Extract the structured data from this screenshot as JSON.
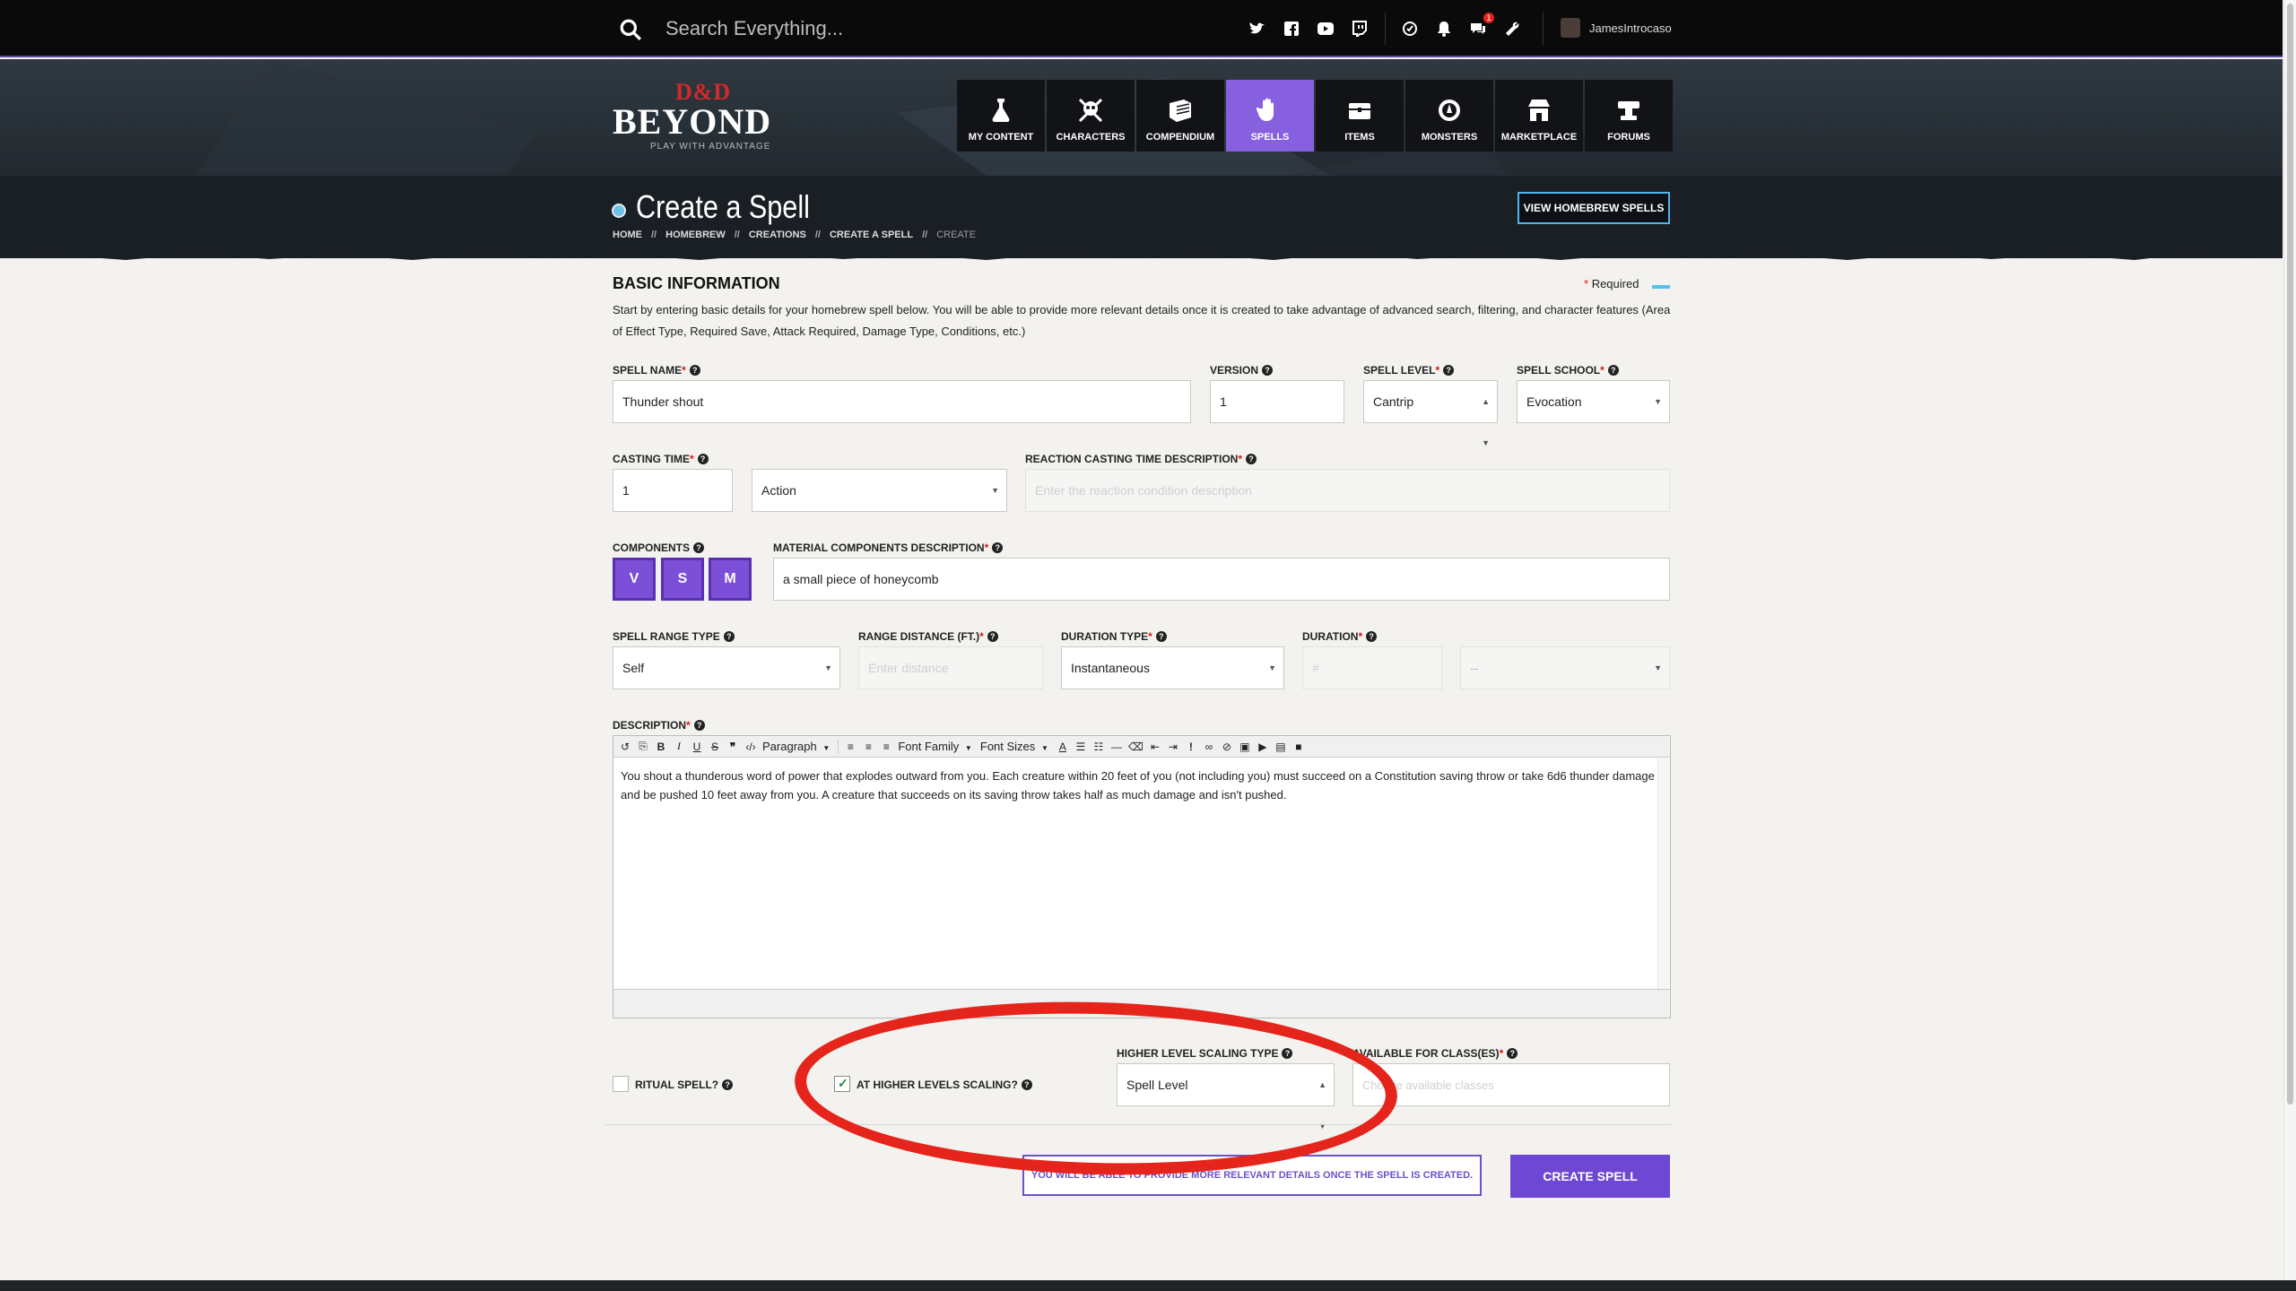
{
  "topbar": {
    "search_placeholder": "Search Everything...",
    "social_icons": [
      "twitter-icon",
      "facebook-icon",
      "youtube-icon",
      "twitch-icon"
    ],
    "notification_badge": "1",
    "username": "JamesIntrocaso"
  },
  "logo": {
    "mark": "D&D",
    "name": "BEYOND",
    "tagline": "PLAY WITH ADVANTAGE"
  },
  "nav": {
    "items": [
      {
        "label": "MY CONTENT",
        "icon": "potion-icon"
      },
      {
        "label": "CHARACTERS",
        "icon": "skull-crossbones-icon"
      },
      {
        "label": "COMPENDIUM",
        "icon": "book-icon"
      },
      {
        "label": "SPELLS",
        "icon": "hand-spell-icon",
        "active": true
      },
      {
        "label": "ITEMS",
        "icon": "chest-icon"
      },
      {
        "label": "MONSTERS",
        "icon": "monster-icon"
      },
      {
        "label": "MARKETPLACE",
        "icon": "shop-icon"
      },
      {
        "label": "FORUMS",
        "icon": "anvil-icon"
      }
    ],
    "active_color": "#8760e0"
  },
  "header": {
    "title": "Create a Spell",
    "breadcrumbs": [
      "HOME",
      "HOMEBREW",
      "CREATIONS",
      "CREATE A SPELL"
    ],
    "breadcrumb_current": "CREATE",
    "breadcrumb_sep": "//",
    "homebrew_button": "VIEW HOMEBREW SPELLS"
  },
  "form": {
    "section_title": "BASIC INFORMATION",
    "required_note": "Required",
    "required_mark": "*",
    "intro": "Start by entering basic details for your homebrew spell below. You will be able to provide more relevant details once it is created to take advantage of advanced search, filtering, and character features (Area of Effect Type, Required Save, Attack Required, Damage Type, Conditions, etc.)",
    "spell_name": {
      "label": "SPELL NAME",
      "value": "Thunder shout"
    },
    "version": {
      "label": "VERSION",
      "value": "1"
    },
    "spell_level": {
      "label": "SPELL LEVEL",
      "value": "Cantrip"
    },
    "spell_school": {
      "label": "SPELL SCHOOL",
      "value": "Evocation"
    },
    "casting_time": {
      "label": "CASTING TIME",
      "value": "1",
      "unit": "Action"
    },
    "reaction_desc": {
      "label": "REACTION CASTING TIME DESCRIPTION",
      "placeholder": "Enter the reaction condition description"
    },
    "components": {
      "label": "COMPONENTS",
      "buttons": [
        "V",
        "S",
        "M"
      ]
    },
    "material_desc": {
      "label": "MATERIAL COMPONENTS DESCRIPTION",
      "value": "a small piece of honeycomb"
    },
    "range_type": {
      "label": "SPELL RANGE TYPE",
      "value": "Self"
    },
    "range_distance": {
      "label": "RANGE DISTANCE (FT.)",
      "placeholder": "Enter distance"
    },
    "duration_type": {
      "label": "DURATION TYPE",
      "value": "Instantaneous"
    },
    "duration": {
      "label": "DURATION",
      "placeholder": "#",
      "unit": "--"
    },
    "description": {
      "label": "DESCRIPTION",
      "toolbar": {
        "paragraph": "Paragraph",
        "font_family": "Font Family",
        "font_sizes": "Font Sizes"
      },
      "text": "You shout a thunderous word of power that explodes outward from you. Each creature within 20 feet of you (not including you) must succeed on a Constitution saving throw or take 6d6 thunder damage and be pushed 10 feet away from you. A creature that succeeds on its saving throw takes half as much damage and isn't pushed."
    },
    "ritual": {
      "label": "RITUAL SPELL?",
      "checked": false
    },
    "higher_levels": {
      "label": "AT HIGHER LEVELS SCALING?",
      "checked": true
    },
    "scaling_type": {
      "label": "HIGHER LEVEL SCALING TYPE",
      "value": "Spell Level"
    },
    "classes": {
      "label": "AVAILABLE FOR CLASS(ES)",
      "placeholder": "Choose available classes"
    },
    "footer_note": "YOU WILL BE ABLE TO PROVIDE MORE RELEVANT DETAILS ONCE THE SPELL IS CREATED.",
    "create_button": "CREATE SPELL"
  },
  "colors": {
    "accent": "#6e48d2",
    "required": "#d21b1b",
    "highlight_ring": "#e5241c"
  }
}
